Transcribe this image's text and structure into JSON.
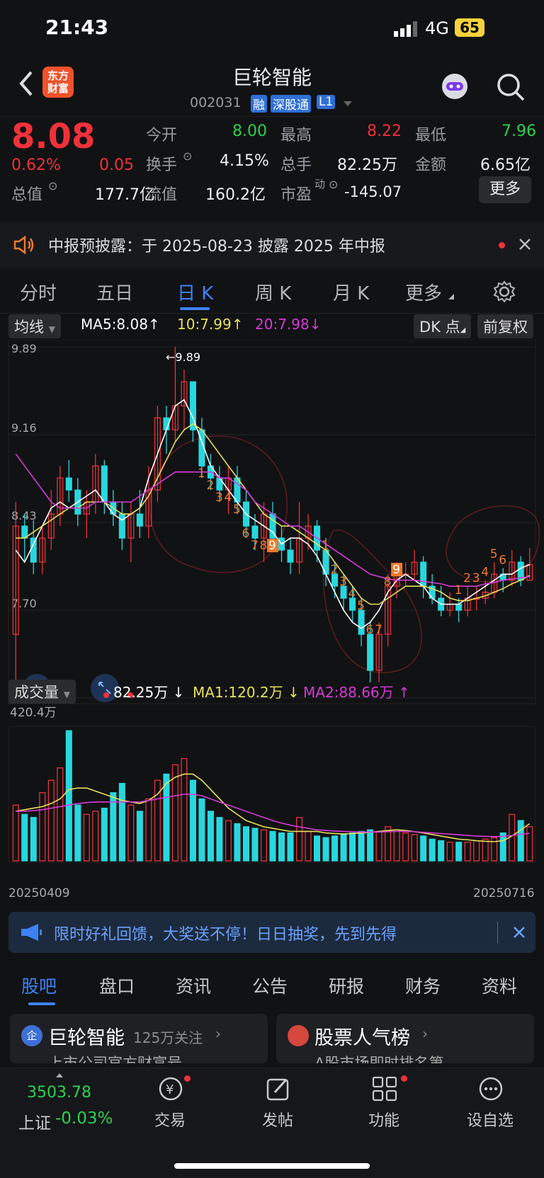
{
  "status": {
    "time": "21:43",
    "network": "4G",
    "battery": "65"
  },
  "header": {
    "title": "巨轮智能",
    "code": "002031",
    "badges": [
      "融",
      "深股通",
      "L1"
    ]
  },
  "quote": {
    "price": "8.08",
    "change_pct": "0.62%",
    "change": "0.05",
    "open_label": "今开",
    "open": "8.00",
    "high_label": "最高",
    "high": "8.22",
    "low_label": "最低",
    "low": "7.96",
    "turnover_label": "换手",
    "turnover": "4.15%",
    "volume_label": "总手",
    "volume": "82.25万",
    "amount_label": "金额",
    "amount": "6.65亿",
    "mktcap_label": "总值",
    "mktcap": "177.7亿",
    "float_label": "流值",
    "float": "160.2亿",
    "pe_label": "市盈",
    "pe_sup": "动",
    "pe": "-145.07",
    "more_button": "更多"
  },
  "notice": {
    "text": "中报预披露：于 2025-08-23 披露 2025 年中报"
  },
  "tabs": [
    {
      "label": "分时"
    },
    {
      "label": "五日"
    },
    {
      "label": "日 K"
    },
    {
      "label": "周 K"
    },
    {
      "label": "月 K"
    },
    {
      "label": "更多"
    }
  ],
  "chart_bar": {
    "ma_select": "均线",
    "ma5": "MA5:8.08",
    "ma10": "10:7.99",
    "ma20": "20:7.98",
    "dk_button": "DK 点",
    "adjust_button": "前复权"
  },
  "volume_bar": {
    "select": "成交量",
    "value": "82.25万",
    "ma1": "MA1:120.2万",
    "ma2": "MA2:88.66万",
    "max_label": "420.4万",
    "start_date": "20250409",
    "end_date": "20250716"
  },
  "colors": {
    "up": "#e8333a",
    "down": "#28d7de",
    "ma5": "#ffffff",
    "ma10": "#e8e05a",
    "ma20": "#d63ad6",
    "accent": "#3d82f5"
  },
  "chart_data": {
    "type": "candlestick",
    "y_ticks": [
      "9.89",
      "9.16",
      "8.43",
      "7.70",
      "6.97"
    ],
    "ylim": [
      6.97,
      9.89
    ],
    "annotations": {
      "max": "9.89",
      "min": "6.97"
    },
    "td_labels": [
      "1",
      "2",
      "3",
      "4",
      "5",
      "6",
      "7",
      "8",
      "9",
      "1",
      "2",
      "3",
      "4",
      "5",
      "6",
      "7",
      "8",
      "9",
      "1",
      "2",
      "3",
      "4",
      "5",
      "6"
    ],
    "candles": [
      [
        7.5,
        8.4,
        8.6,
        6.97
      ],
      [
        8.4,
        8.3,
        8.5,
        8.1
      ],
      [
        8.3,
        8.1,
        8.45,
        8.0
      ],
      [
        8.1,
        8.3,
        8.4,
        8.0
      ],
      [
        8.3,
        8.5,
        8.7,
        8.2
      ],
      [
        8.5,
        8.8,
        8.9,
        8.4
      ],
      [
        8.8,
        8.7,
        8.95,
        8.6
      ],
      [
        8.7,
        8.5,
        8.8,
        8.4
      ],
      [
        8.5,
        8.6,
        8.7,
        8.3
      ],
      [
        8.6,
        8.9,
        9.0,
        8.5
      ],
      [
        8.9,
        8.6,
        8.95,
        8.5
      ],
      [
        8.6,
        8.5,
        8.7,
        8.4
      ],
      [
        8.5,
        8.3,
        8.6,
        8.2
      ],
      [
        8.3,
        8.5,
        8.6,
        8.1
      ],
      [
        8.5,
        8.4,
        8.7,
        8.3
      ],
      [
        8.4,
        8.7,
        8.9,
        8.3
      ],
      [
        8.7,
        9.3,
        9.4,
        8.6
      ],
      [
        9.3,
        9.2,
        9.4,
        9.0
      ],
      [
        9.2,
        9.4,
        9.89,
        9.1
      ],
      [
        9.4,
        9.6,
        9.7,
        9.2
      ],
      [
        9.6,
        9.2,
        9.6,
        9.1
      ],
      [
        9.2,
        8.9,
        9.3,
        8.8
      ],
      [
        8.9,
        8.8,
        9.0,
        8.7
      ],
      [
        8.8,
        8.7,
        8.9,
        8.6
      ],
      [
        8.7,
        8.8,
        8.9,
        8.5
      ],
      [
        8.8,
        8.6,
        8.9,
        8.5
      ],
      [
        8.6,
        8.4,
        8.7,
        8.3
      ],
      [
        8.4,
        8.3,
        8.5,
        8.2
      ],
      [
        8.3,
        8.5,
        8.6,
        8.1
      ],
      [
        8.5,
        8.3,
        8.6,
        8.2
      ],
      [
        8.3,
        8.2,
        8.4,
        8.1
      ],
      [
        8.2,
        8.1,
        8.3,
        8.0
      ],
      [
        8.1,
        8.3,
        8.6,
        8.0
      ],
      [
        8.3,
        8.4,
        8.5,
        8.2
      ],
      [
        8.4,
        8.2,
        8.45,
        8.1
      ],
      [
        8.2,
        8.0,
        8.3,
        7.9
      ],
      [
        8.0,
        7.9,
        8.1,
        7.8
      ],
      [
        7.9,
        7.8,
        8.0,
        7.7
      ],
      [
        7.8,
        7.7,
        7.9,
        7.6
      ],
      [
        7.7,
        7.5,
        7.8,
        7.4
      ],
      [
        7.5,
        7.2,
        7.6,
        7.1
      ],
      [
        7.2,
        7.5,
        7.6,
        7.1
      ],
      [
        7.5,
        7.9,
        8.0,
        7.4
      ],
      [
        7.9,
        8.0,
        8.1,
        7.8
      ],
      [
        8.0,
        8.0,
        8.1,
        7.9
      ],
      [
        8.0,
        8.1,
        8.2,
        7.95
      ],
      [
        8.1,
        7.9,
        8.15,
        7.8
      ],
      [
        7.9,
        7.8,
        8.0,
        7.75
      ],
      [
        7.8,
        7.7,
        7.9,
        7.65
      ],
      [
        7.7,
        7.75,
        7.85,
        7.65
      ],
      [
        7.75,
        7.7,
        7.8,
        7.6
      ],
      [
        7.7,
        7.8,
        7.9,
        7.65
      ],
      [
        7.8,
        7.8,
        7.9,
        7.7
      ],
      [
        7.8,
        7.85,
        7.95,
        7.75
      ],
      [
        7.85,
        8.0,
        8.1,
        7.8
      ],
      [
        8.0,
        7.95,
        8.05,
        7.85
      ],
      [
        7.95,
        8.1,
        8.2,
        7.9
      ],
      [
        8.1,
        7.95,
        8.15,
        7.9
      ],
      [
        7.95,
        8.08,
        8.22,
        7.96
      ]
    ],
    "ma5": [
      8.2,
      8.1,
      8.25,
      8.4,
      8.55,
      8.6,
      8.55,
      8.6,
      8.65,
      8.7,
      8.6,
      8.5,
      8.45,
      8.5,
      8.55,
      8.8,
      9.0,
      9.2,
      9.4,
      9.45,
      9.3,
      9.1,
      8.9,
      8.8,
      8.7,
      8.6,
      8.5,
      8.45,
      8.4,
      8.35,
      8.25,
      8.3,
      8.3,
      8.25,
      8.15,
      8.0,
      7.85,
      7.7,
      7.6,
      7.55,
      7.6,
      7.7,
      7.85,
      7.95,
      8.0,
      7.95,
      7.9,
      7.8,
      7.75,
      7.75,
      7.75,
      7.8,
      7.85,
      7.9,
      7.95,
      8.0,
      8.0,
      8.05,
      8.08
    ],
    "ma10": [
      8.3,
      8.3,
      8.35,
      8.4,
      8.45,
      8.5,
      8.55,
      8.55,
      8.6,
      8.6,
      8.6,
      8.55,
      8.5,
      8.5,
      8.55,
      8.65,
      8.8,
      8.95,
      9.1,
      9.2,
      9.25,
      9.2,
      9.1,
      9.0,
      8.9,
      8.8,
      8.7,
      8.6,
      8.5,
      8.45,
      8.4,
      8.4,
      8.35,
      8.3,
      8.25,
      8.2,
      8.1,
      8.0,
      7.9,
      7.8,
      7.75,
      7.75,
      7.8,
      7.85,
      7.9,
      7.9,
      7.9,
      7.88,
      7.85,
      7.8,
      7.78,
      7.78,
      7.8,
      7.82,
      7.85,
      7.88,
      7.92,
      7.95,
      7.99
    ],
    "ma20": [
      9.0,
      8.9,
      8.8,
      8.7,
      8.6,
      8.55,
      8.55,
      8.55,
      8.55,
      8.6,
      8.6,
      8.6,
      8.6,
      8.6,
      8.65,
      8.7,
      8.75,
      8.8,
      8.85,
      8.85,
      8.85,
      8.85,
      8.85,
      8.8,
      8.8,
      8.75,
      8.7,
      8.6,
      8.55,
      8.5,
      8.45,
      8.4,
      8.4,
      8.35,
      8.3,
      8.25,
      8.2,
      8.15,
      8.1,
      8.05,
      8.0,
      7.98,
      7.96,
      7.95,
      7.95,
      7.95,
      7.94,
      7.93,
      7.92,
      7.9,
      7.9,
      7.9,
      7.9,
      7.92,
      7.93,
      7.95,
      7.96,
      7.97,
      7.98
    ],
    "volume": [
      180,
      150,
      140,
      220,
      260,
      300,
      420,
      180,
      150,
      160,
      170,
      220,
      250,
      180,
      160,
      200,
      260,
      280,
      310,
      330,
      260,
      200,
      160,
      140,
      130,
      120,
      110,
      105,
      100,
      95,
      90,
      90,
      140,
      95,
      80,
      75,
      80,
      85,
      90,
      95,
      100,
      95,
      110,
      100,
      90,
      85,
      80,
      70,
      65,
      60,
      60,
      60,
      65,
      70,
      75,
      90,
      150,
      130,
      110
    ],
    "vol_ma1": [
      160,
      165,
      170,
      175,
      185,
      200,
      230,
      235,
      235,
      225,
      215,
      205,
      195,
      190,
      185,
      195,
      215,
      250,
      270,
      280,
      280,
      260,
      230,
      200,
      170,
      150,
      130,
      120,
      110,
      105,
      100,
      95,
      95,
      95,
      95,
      90,
      88,
      87,
      88,
      90,
      92,
      95,
      98,
      100,
      98,
      94,
      90,
      85,
      80,
      75,
      70,
      68,
      65,
      63,
      62,
      65,
      80,
      100,
      120
    ],
    "vol_ma2": [
      160,
      160,
      162,
      165,
      170,
      175,
      180,
      185,
      188,
      190,
      190,
      190,
      190,
      190,
      190,
      195,
      200,
      205,
      210,
      215,
      215,
      210,
      200,
      190,
      180,
      170,
      160,
      150,
      140,
      130,
      122,
      115,
      110,
      105,
      100,
      98,
      96,
      95,
      94,
      93,
      93,
      93,
      94,
      95,
      95,
      94,
      92,
      90,
      88,
      86,
      84,
      82,
      80,
      79,
      78,
      79,
      82,
      86,
      88.66
    ]
  },
  "promo": {
    "text": "限时好礼回馈，大奖送不停！日日抽奖，先到先得"
  },
  "subtabs": [
    {
      "label": "股吧"
    },
    {
      "label": "盘口"
    },
    {
      "label": "资讯"
    },
    {
      "label": "公告"
    },
    {
      "label": "研报"
    },
    {
      "label": "财务"
    },
    {
      "label": "资料"
    }
  ],
  "cards": {
    "left_title": "巨轮智能",
    "left_meta": "125万关注",
    "left_sub": "上市公司官方财富号",
    "right_title": "股票人气榜",
    "right_sub": "A股市场即时排名第"
  },
  "bottom": {
    "index_value": "3503.78",
    "index_name": "上证",
    "index_change": "-0.03%",
    "items": [
      {
        "label": "交易"
      },
      {
        "label": "发帖"
      },
      {
        "label": "功能"
      },
      {
        "label": "设自选"
      }
    ]
  }
}
